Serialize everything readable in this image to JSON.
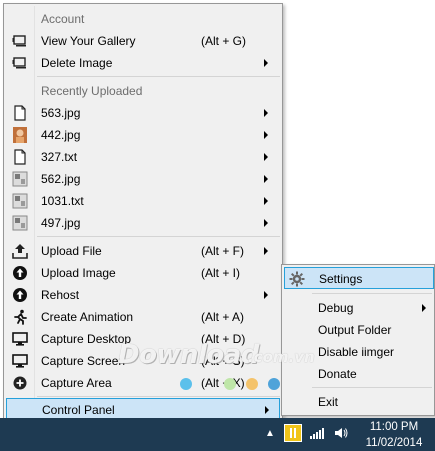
{
  "menu": {
    "account_header": "Account",
    "view_gallery": {
      "label": "View Your Gallery",
      "shortcut": "(Alt + G)",
      "icon": "gallery-icon"
    },
    "delete_image": {
      "label": "Delete Image",
      "icon": "gallery-icon"
    },
    "recent_header": "Recently Uploaded",
    "recent": [
      {
        "label": "563.jpg",
        "icon": "file-icon"
      },
      {
        "label": "442.jpg",
        "icon": "photo-thumbnail-icon"
      },
      {
        "label": "327.txt",
        "icon": "file-icon"
      },
      {
        "label": "562.jpg",
        "icon": "image-thumbnail-icon"
      },
      {
        "label": "1031.txt",
        "icon": "image-thumbnail-icon"
      },
      {
        "label": "497.jpg",
        "icon": "image-thumbnail-icon"
      }
    ],
    "upload_file": {
      "label": "Upload File",
      "shortcut": "(Alt + F)",
      "icon": "upload-icon"
    },
    "upload_image": {
      "label": "Upload Image",
      "shortcut": "(Alt + I)",
      "icon": "upload-circle-icon"
    },
    "rehost": {
      "label": "Rehost",
      "icon": "upload-circle-icon"
    },
    "create_animation": {
      "label": "Create Animation",
      "shortcut": "(Alt + A)",
      "icon": "running-icon"
    },
    "capture_desktop": {
      "label": "Capture Desktop",
      "shortcut": "(Alt + D)",
      "icon": "monitor-icon"
    },
    "capture_screen": {
      "label": "Capture Screen",
      "shortcut": "(Alt + S)",
      "icon": "monitor-icon"
    },
    "capture_area": {
      "label": "Capture Area",
      "shortcut": "(Alt + X)",
      "icon": "plus-circle-icon"
    },
    "control_panel": {
      "label": "Control Panel"
    }
  },
  "color_dots": [
    "#5bc0eb",
    "#bfe6a8",
    "#f4c36b",
    "#4fa3d9",
    "#ef6f7a"
  ],
  "submenu": {
    "settings": {
      "label": "Settings",
      "icon": "gear-icon"
    },
    "debug": "Debug",
    "output_folder": "Output Folder",
    "disable": "Disable iimger",
    "donate": "Donate",
    "exit": "Exit"
  },
  "watermark": {
    "text": "Download",
    "suffix": ".com.vn"
  },
  "taskbar": {
    "time": "11:00 PM",
    "date": "11/02/2014"
  },
  "colors": {
    "highlight": "#cce4f7",
    "highlight_border": "#26a0da",
    "taskbar": "#1e3a52"
  }
}
